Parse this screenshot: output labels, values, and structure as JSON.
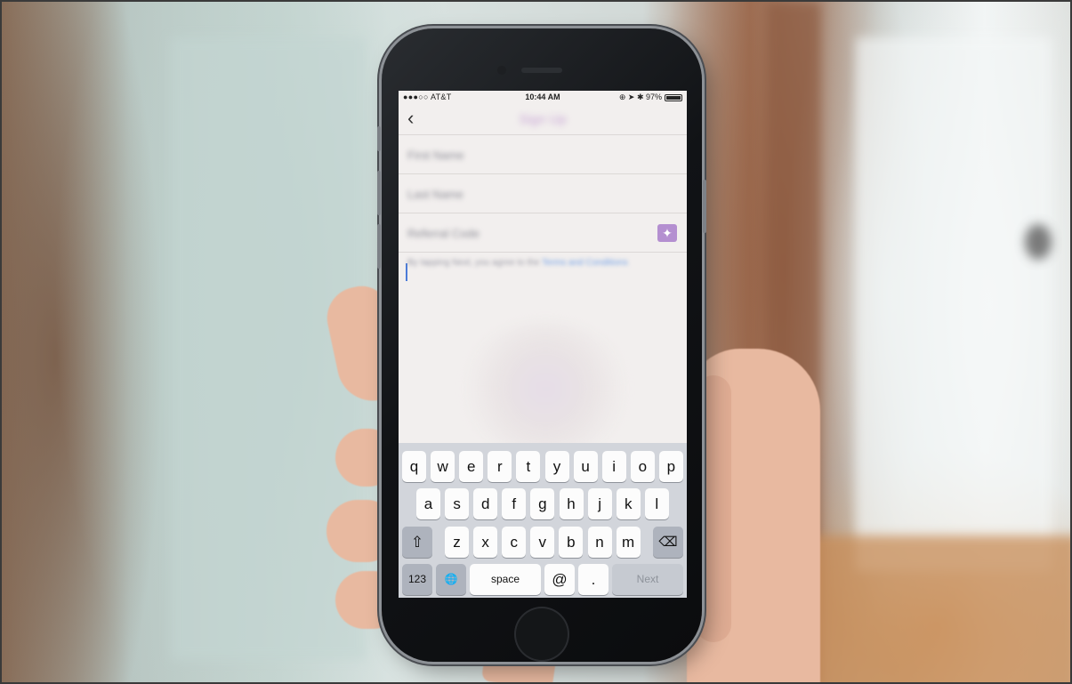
{
  "status_bar": {
    "carrier": "●●●○○ AT&T",
    "time": "10:44 AM",
    "right_icons": "⊕ ➤ ✱ 97%",
    "battery_percent": 97
  },
  "nav": {
    "back_icon": "chevron-left-icon",
    "back_glyph": "‹",
    "title": "Sign Up"
  },
  "form": {
    "fields": [
      {
        "name": "first-name",
        "placeholder": "First Name"
      },
      {
        "name": "last-name",
        "placeholder": "Last Name"
      },
      {
        "name": "referral-code",
        "placeholder": "Referral Code"
      }
    ],
    "terms": {
      "text": "By tapping Next, you agree to the ",
      "link": "Terms and Conditions"
    },
    "gift_icon": "gift-icon"
  },
  "keyboard": {
    "row1": [
      "q",
      "w",
      "e",
      "r",
      "t",
      "y",
      "u",
      "i",
      "o",
      "p"
    ],
    "row2": [
      "a",
      "s",
      "d",
      "f",
      "g",
      "h",
      "j",
      "k",
      "l"
    ],
    "row3": [
      "z",
      "x",
      "c",
      "v",
      "b",
      "n",
      "m"
    ],
    "shift_glyph": "⇧",
    "delete_glyph": "⌫",
    "numbers_label": "123",
    "globe_glyph": "🌐",
    "space_label": "space",
    "at_label": "@",
    "period_label": ".",
    "next_label": "Next"
  }
}
